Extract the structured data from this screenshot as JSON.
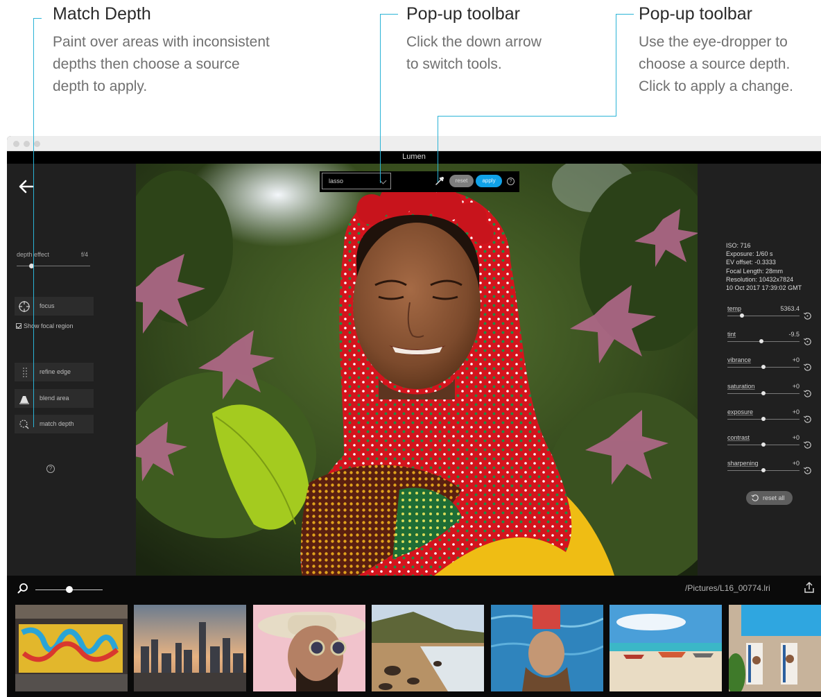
{
  "annotations": {
    "match_depth": {
      "title": "Match Depth",
      "lines": [
        "Paint over areas with inconsistent",
        "depths then choose a source",
        "depth to apply."
      ]
    },
    "popup_switch": {
      "title": "Pop-up toolbar",
      "lines": [
        "Click the down arrow",
        "to switch tools."
      ]
    },
    "popup_eyedropper": {
      "title": "Pop-up toolbar",
      "lines": [
        "Use the eye-dropper to",
        "choose a source depth.",
        "Click to apply a change."
      ]
    },
    "accent_color": "#2ab3d6"
  },
  "app": {
    "title": "Lumen"
  },
  "left_panel": {
    "back_icon": "arrow-left-icon",
    "depth_effect": {
      "label": "depth effect",
      "value": "f/4",
      "level": 0.2
    },
    "focus_label": "focus",
    "show_focal_label": "Show focal region",
    "show_focal_checked": true,
    "refine_edge_label": "refine edge",
    "blend_area_label": "blend area",
    "match_depth_label": "match depth",
    "help_glyph": "?"
  },
  "popup": {
    "tool_selected": "lasso",
    "reset_label": "reset",
    "apply_label": "apply",
    "help_glyph": "?",
    "apply_color": "#10a2e8"
  },
  "right_panel": {
    "metadata": [
      "ISO: 716",
      "Exposure: 1/60 s",
      "EV offset: -0.3333",
      "Focal Length: 28mm",
      "Resolution: 10432x7824",
      "10 Oct 2017 17:39:02 GMT"
    ],
    "adjustments": [
      {
        "name": "temp",
        "value": "5363.4",
        "level": 0.2
      },
      {
        "name": "tint",
        "value": "-9.5",
        "level": 0.47
      },
      {
        "name": "vibrance",
        "value": "+0",
        "level": 0.5
      },
      {
        "name": "saturation",
        "value": "+0",
        "level": 0.5
      },
      {
        "name": "exposure",
        "value": "+0",
        "level": 0.5
      },
      {
        "name": "contrast",
        "value": "+0",
        "level": 0.5
      },
      {
        "name": "sharpening",
        "value": "+0",
        "level": 0.5
      }
    ],
    "reset_all_label": "reset all"
  },
  "bottom": {
    "zoom_level": 0.5,
    "file_path": "/Pictures/L16_00774.lri",
    "thumbnails": [
      "graffiti-wall",
      "city-skyline",
      "man-in-hat",
      "beach-rocks",
      "woman-in-pool",
      "boats-on-beach",
      "poolside-loungers"
    ]
  }
}
